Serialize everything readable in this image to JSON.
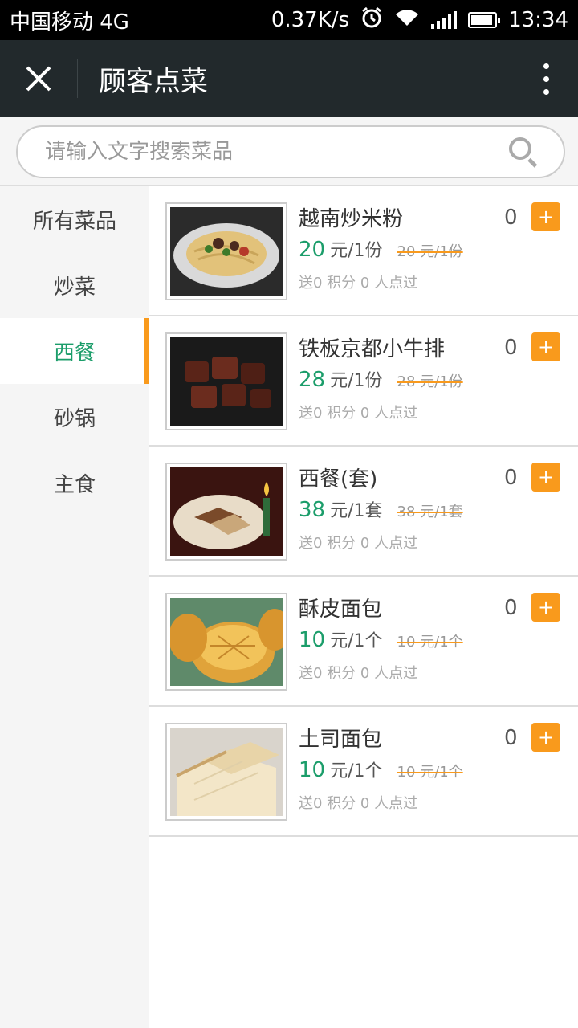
{
  "statusbar": {
    "carrier": "中国移动 4G",
    "speed": "0.37K/s",
    "time": "13:34",
    "icons": [
      "alarm-icon",
      "wifi-icon",
      "signal-icon",
      "battery-icon"
    ]
  },
  "titlebar": {
    "title": "顾客点菜",
    "close_icon": "close-icon",
    "more_icon": "more-vertical-icon"
  },
  "search": {
    "placeholder": "请输入文字搜索菜品",
    "value": ""
  },
  "categories": [
    {
      "label": "所有菜品",
      "active": false
    },
    {
      "label": "炒菜",
      "active": false
    },
    {
      "label": "西餐",
      "active": true
    },
    {
      "label": "砂锅",
      "active": false
    },
    {
      "label": "主食",
      "active": false
    }
  ],
  "items": [
    {
      "name": "越南炒米粉",
      "price": "20",
      "unit": "元/1份",
      "orig": "20 元/1份",
      "meta": "送0 积分 0 人点过",
      "qty": "0",
      "add": "+"
    },
    {
      "name": "铁板京都小牛排",
      "price": "28",
      "unit": "元/1份",
      "orig": "28 元/1份",
      "meta": "送0 积分 0 人点过",
      "qty": "0",
      "add": "+"
    },
    {
      "name": "西餐(套)",
      "price": "38",
      "unit": "元/1套",
      "orig": "38 元/1套",
      "meta": "送0 积分 0 人点过",
      "qty": "0",
      "add": "+"
    },
    {
      "name": "酥皮面包",
      "price": "10",
      "unit": "元/1个",
      "orig": "10 元/1个",
      "meta": "送0 积分 0 人点过",
      "qty": "0",
      "add": "+"
    },
    {
      "name": "土司面包",
      "price": "10",
      "unit": "元/1个",
      "orig": "10 元/1个",
      "meta": "送0 积分 0 人点过",
      "qty": "0",
      "add": "+"
    }
  ],
  "colors": {
    "accent_green": "#1b9d6a",
    "accent_orange": "#f99a1c",
    "titlebar_bg": "#22292c"
  }
}
